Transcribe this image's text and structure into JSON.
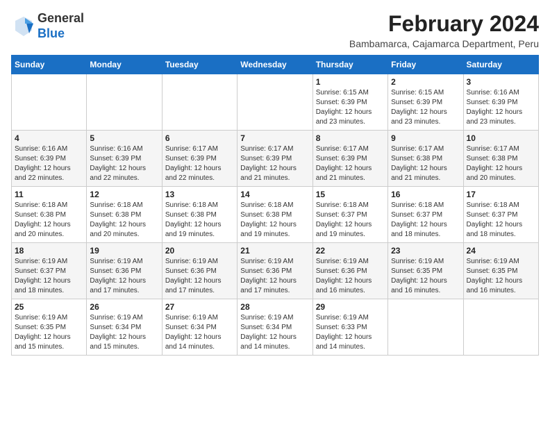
{
  "logo": {
    "general": "General",
    "blue": "Blue"
  },
  "header": {
    "month": "February 2024",
    "location": "Bambamarca, Cajamarca Department, Peru"
  },
  "weekdays": [
    "Sunday",
    "Monday",
    "Tuesday",
    "Wednesday",
    "Thursday",
    "Friday",
    "Saturday"
  ],
  "weeks": [
    [
      {
        "day": "",
        "info": ""
      },
      {
        "day": "",
        "info": ""
      },
      {
        "day": "",
        "info": ""
      },
      {
        "day": "",
        "info": ""
      },
      {
        "day": "1",
        "info": "Sunrise: 6:15 AM\nSunset: 6:39 PM\nDaylight: 12 hours and 23 minutes."
      },
      {
        "day": "2",
        "info": "Sunrise: 6:15 AM\nSunset: 6:39 PM\nDaylight: 12 hours and 23 minutes."
      },
      {
        "day": "3",
        "info": "Sunrise: 6:16 AM\nSunset: 6:39 PM\nDaylight: 12 hours and 23 minutes."
      }
    ],
    [
      {
        "day": "4",
        "info": "Sunrise: 6:16 AM\nSunset: 6:39 PM\nDaylight: 12 hours and 22 minutes."
      },
      {
        "day": "5",
        "info": "Sunrise: 6:16 AM\nSunset: 6:39 PM\nDaylight: 12 hours and 22 minutes."
      },
      {
        "day": "6",
        "info": "Sunrise: 6:17 AM\nSunset: 6:39 PM\nDaylight: 12 hours and 22 minutes."
      },
      {
        "day": "7",
        "info": "Sunrise: 6:17 AM\nSunset: 6:39 PM\nDaylight: 12 hours and 21 minutes."
      },
      {
        "day": "8",
        "info": "Sunrise: 6:17 AM\nSunset: 6:39 PM\nDaylight: 12 hours and 21 minutes."
      },
      {
        "day": "9",
        "info": "Sunrise: 6:17 AM\nSunset: 6:38 PM\nDaylight: 12 hours and 21 minutes."
      },
      {
        "day": "10",
        "info": "Sunrise: 6:17 AM\nSunset: 6:38 PM\nDaylight: 12 hours and 20 minutes."
      }
    ],
    [
      {
        "day": "11",
        "info": "Sunrise: 6:18 AM\nSunset: 6:38 PM\nDaylight: 12 hours and 20 minutes."
      },
      {
        "day": "12",
        "info": "Sunrise: 6:18 AM\nSunset: 6:38 PM\nDaylight: 12 hours and 20 minutes."
      },
      {
        "day": "13",
        "info": "Sunrise: 6:18 AM\nSunset: 6:38 PM\nDaylight: 12 hours and 19 minutes."
      },
      {
        "day": "14",
        "info": "Sunrise: 6:18 AM\nSunset: 6:38 PM\nDaylight: 12 hours and 19 minutes."
      },
      {
        "day": "15",
        "info": "Sunrise: 6:18 AM\nSunset: 6:37 PM\nDaylight: 12 hours and 19 minutes."
      },
      {
        "day": "16",
        "info": "Sunrise: 6:18 AM\nSunset: 6:37 PM\nDaylight: 12 hours and 18 minutes."
      },
      {
        "day": "17",
        "info": "Sunrise: 6:18 AM\nSunset: 6:37 PM\nDaylight: 12 hours and 18 minutes."
      }
    ],
    [
      {
        "day": "18",
        "info": "Sunrise: 6:19 AM\nSunset: 6:37 PM\nDaylight: 12 hours and 18 minutes."
      },
      {
        "day": "19",
        "info": "Sunrise: 6:19 AM\nSunset: 6:36 PM\nDaylight: 12 hours and 17 minutes."
      },
      {
        "day": "20",
        "info": "Sunrise: 6:19 AM\nSunset: 6:36 PM\nDaylight: 12 hours and 17 minutes."
      },
      {
        "day": "21",
        "info": "Sunrise: 6:19 AM\nSunset: 6:36 PM\nDaylight: 12 hours and 17 minutes."
      },
      {
        "day": "22",
        "info": "Sunrise: 6:19 AM\nSunset: 6:36 PM\nDaylight: 12 hours and 16 minutes."
      },
      {
        "day": "23",
        "info": "Sunrise: 6:19 AM\nSunset: 6:35 PM\nDaylight: 12 hours and 16 minutes."
      },
      {
        "day": "24",
        "info": "Sunrise: 6:19 AM\nSunset: 6:35 PM\nDaylight: 12 hours and 16 minutes."
      }
    ],
    [
      {
        "day": "25",
        "info": "Sunrise: 6:19 AM\nSunset: 6:35 PM\nDaylight: 12 hours and 15 minutes."
      },
      {
        "day": "26",
        "info": "Sunrise: 6:19 AM\nSunset: 6:34 PM\nDaylight: 12 hours and 15 minutes."
      },
      {
        "day": "27",
        "info": "Sunrise: 6:19 AM\nSunset: 6:34 PM\nDaylight: 12 hours and 14 minutes."
      },
      {
        "day": "28",
        "info": "Sunrise: 6:19 AM\nSunset: 6:34 PM\nDaylight: 12 hours and 14 minutes."
      },
      {
        "day": "29",
        "info": "Sunrise: 6:19 AM\nSunset: 6:33 PM\nDaylight: 12 hours and 14 minutes."
      },
      {
        "day": "",
        "info": ""
      },
      {
        "day": "",
        "info": ""
      }
    ]
  ]
}
